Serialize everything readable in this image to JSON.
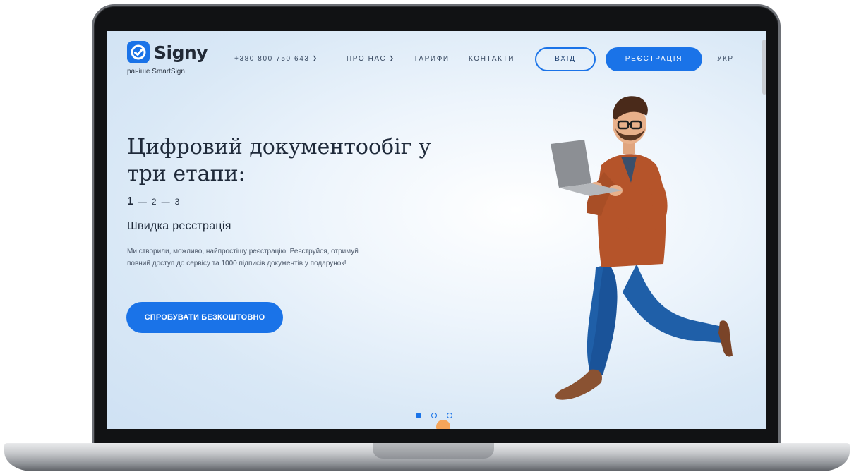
{
  "header": {
    "logo_name": "Signy",
    "logo_subtitle": "раніше SmartSign",
    "phone": "+380 800 750 643",
    "nav": {
      "about": "ПРО НАС",
      "pricing": "ТАРИФИ",
      "contacts": "КОНТАКТИ"
    },
    "login_label": "ВХІД",
    "register_label": "РЕЄСТРАЦІЯ",
    "language": "УКР"
  },
  "hero": {
    "title": "Цифровий документообіг у три етапи:",
    "steps": [
      "1",
      "2",
      "3"
    ],
    "active_step": 1,
    "subtitle": "Швидка реєстрація",
    "description": "Ми створили, можливо, найпростішу реєстрацію. Реєструйся, отримуй повний доступ до сервісу та 1000 підписів документів у подарунок!",
    "cta_label": "СПРОБУВАТИ БЕЗКОШТОВНО"
  },
  "slider": {
    "slide_count": 3,
    "active_slide": 1
  },
  "icons": {
    "logo": "signy-check-icon",
    "dropdown": "chevron-down-icon"
  },
  "colors": {
    "accent": "#1a73e8",
    "text_dark": "#1f2a3a",
    "shirt": "#b5542a",
    "jeans": "#1f5fa8"
  }
}
